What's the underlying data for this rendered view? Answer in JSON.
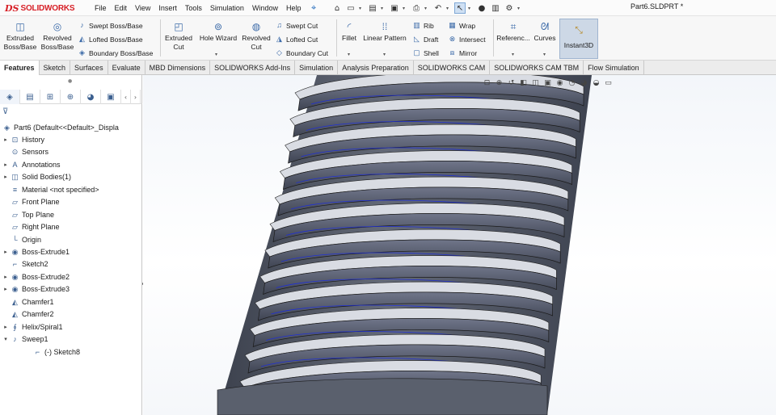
{
  "app": {
    "brand_prefix": "DS",
    "brand": "SOLIDWORKS"
  },
  "menu": [
    "File",
    "Edit",
    "View",
    "Insert",
    "Tools",
    "Simulation",
    "Window",
    "Help"
  ],
  "document": {
    "title": "Part6.SLDPRT *"
  },
  "command_manager": {
    "extruded_boss": "Extruded Boss/Base",
    "revolved_boss": "Revolved Boss/Base",
    "swept_boss": "Swept Boss/Base",
    "lofted_boss": "Lofted Boss/Base",
    "boundary_boss": "Boundary Boss/Base",
    "extruded_cut": "Extruded Cut",
    "hole_wizard": "Hole Wizard",
    "revolved_cut": "Revolved Cut",
    "swept_cut": "Swept Cut",
    "lofted_cut": "Lofted Cut",
    "boundary_cut": "Boundary Cut",
    "fillet": "Fillet",
    "linear_pattern": "Linear Pattern",
    "rib": "Rib",
    "draft": "Draft",
    "shell": "Shell",
    "wrap": "Wrap",
    "intersect": "Intersect",
    "mirror": "Mirror",
    "reference": "Referenc...",
    "curves": "Curves",
    "instant3d": "Instant3D"
  },
  "tabs": [
    {
      "label": "Features",
      "active": true
    },
    {
      "label": "Sketch"
    },
    {
      "label": "Surfaces"
    },
    {
      "label": "Evaluate"
    },
    {
      "label": "MBD Dimensions"
    },
    {
      "label": "SOLIDWORKS Add-Ins"
    },
    {
      "label": "Simulation"
    },
    {
      "label": "Analysis Preparation"
    },
    {
      "label": "SOLIDWORKS CAM"
    },
    {
      "label": "SOLIDWORKS CAM TBM"
    },
    {
      "label": "Flow Simulation"
    }
  ],
  "feature_tree": [
    {
      "label": "Part6  (Default<<Default>_Displa",
      "icon": "part-icon",
      "glyph": "◈",
      "expand": "",
      "indent": 0
    },
    {
      "label": "History",
      "icon": "history-icon",
      "glyph": "⊡",
      "expand": "▸",
      "indent": 1
    },
    {
      "label": "Sensors",
      "icon": "sensor-icon",
      "glyph": "⊙",
      "expand": "",
      "indent": 1
    },
    {
      "label": "Annotations",
      "icon": "annotation-icon",
      "glyph": "A",
      "expand": "▸",
      "indent": 1
    },
    {
      "label": "Solid Bodies(1)",
      "icon": "solid-bodies-icon",
      "glyph": "◫",
      "expand": "▸",
      "indent": 1
    },
    {
      "label": "Material <not specified>",
      "icon": "material-icon",
      "glyph": "≡",
      "expand": "",
      "indent": 1
    },
    {
      "label": "Front Plane",
      "icon": "plane-icon",
      "glyph": "▱",
      "expand": "",
      "indent": 1
    },
    {
      "label": "Top Plane",
      "icon": "plane-icon",
      "glyph": "▱",
      "expand": "",
      "indent": 1
    },
    {
      "label": "Right Plane",
      "icon": "plane-icon",
      "glyph": "▱",
      "expand": "",
      "indent": 1
    },
    {
      "label": "Origin",
      "icon": "origin-icon",
      "glyph": "└",
      "expand": "",
      "indent": 1
    },
    {
      "label": "Boss-Extrude1",
      "icon": "extrude-icon",
      "glyph": "◉",
      "expand": "▸",
      "indent": 1
    },
    {
      "label": "Sketch2",
      "icon": "sketch-icon",
      "glyph": "⌐",
      "expand": "",
      "indent": 1
    },
    {
      "label": "Boss-Extrude2",
      "icon": "extrude-icon",
      "glyph": "◉",
      "expand": "▸",
      "indent": 1
    },
    {
      "label": "Boss-Extrude3",
      "icon": "extrude-icon",
      "glyph": "◉",
      "expand": "▸",
      "indent": 1
    },
    {
      "label": "Chamfer1",
      "icon": "chamfer-icon",
      "glyph": "◭",
      "expand": "",
      "indent": 1
    },
    {
      "label": "Chamfer2",
      "icon": "chamfer-icon",
      "glyph": "◭",
      "expand": "",
      "indent": 1
    },
    {
      "label": "Helix/Spiral1",
      "icon": "helix-icon",
      "glyph": "∮",
      "expand": "▸",
      "indent": 1
    },
    {
      "label": "Sweep1",
      "icon": "sweep-icon",
      "glyph": "♪",
      "expand": "▾",
      "indent": 1
    },
    {
      "label": "(-) Sketch8",
      "icon": "sketch-icon",
      "glyph": "⌐",
      "expand": "",
      "indent": 2
    }
  ],
  "colors": {
    "accent": "#2b6bb8",
    "thread_dark": "#4a4f5c",
    "thread_light": "#d9dce3",
    "helix_blue": "#1f2fd6"
  }
}
